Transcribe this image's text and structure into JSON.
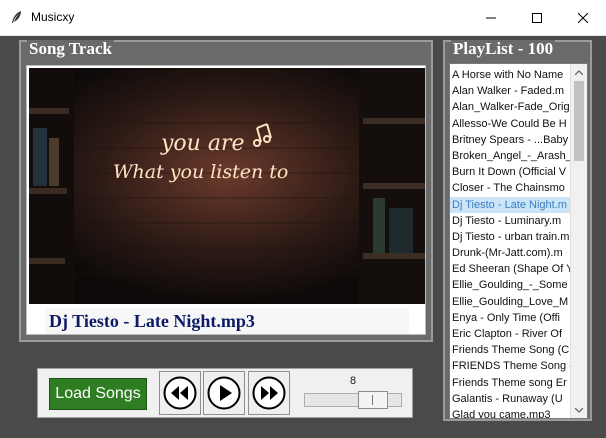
{
  "window": {
    "title": "Musicxy"
  },
  "song_track": {
    "label": "Song Track",
    "artwork_text_line1": "you are",
    "artwork_text_line2": "What you listen to",
    "now_playing": "Dj Tiesto - Late Night.mp3"
  },
  "playlist": {
    "label": "PlayList - 100",
    "items": [
      "A Horse with No Name",
      "Alan Walker - Faded.m",
      "Alan_Walker-Fade_Orig",
      "Allesso-We Could Be H",
      "Britney Spears - ...Baby",
      "Broken_Angel_-_Arash_",
      "Burn It Down (Official V",
      "Closer - The Chainsmo",
      "Dj Tiesto - Late Night.m",
      "Dj Tiesto - Luminary.m",
      "Dj Tiesto - urban train.m",
      "Drunk-(Mr-Jatt.com).m",
      "Ed Sheeran (Shape Of Y",
      "Ellie_Goulding_-_Some",
      "Ellie_Goulding_Love_M",
      "Enya - Only Time (Offi",
      "Eric Clapton - River Of",
      "Friends Theme Song (C",
      "FRIENDS Theme Song -",
      "Friends Theme song Er",
      "Galantis - Runaway (U",
      "Glad you came.mp3"
    ],
    "selected_index": 8
  },
  "controls": {
    "load_label": "Load Songs",
    "volume": 8,
    "volume_max": 10
  },
  "colors": {
    "load_button": "#2f7d23",
    "now_playing_text": "#0c1a67",
    "selection": "#cce4f7"
  }
}
